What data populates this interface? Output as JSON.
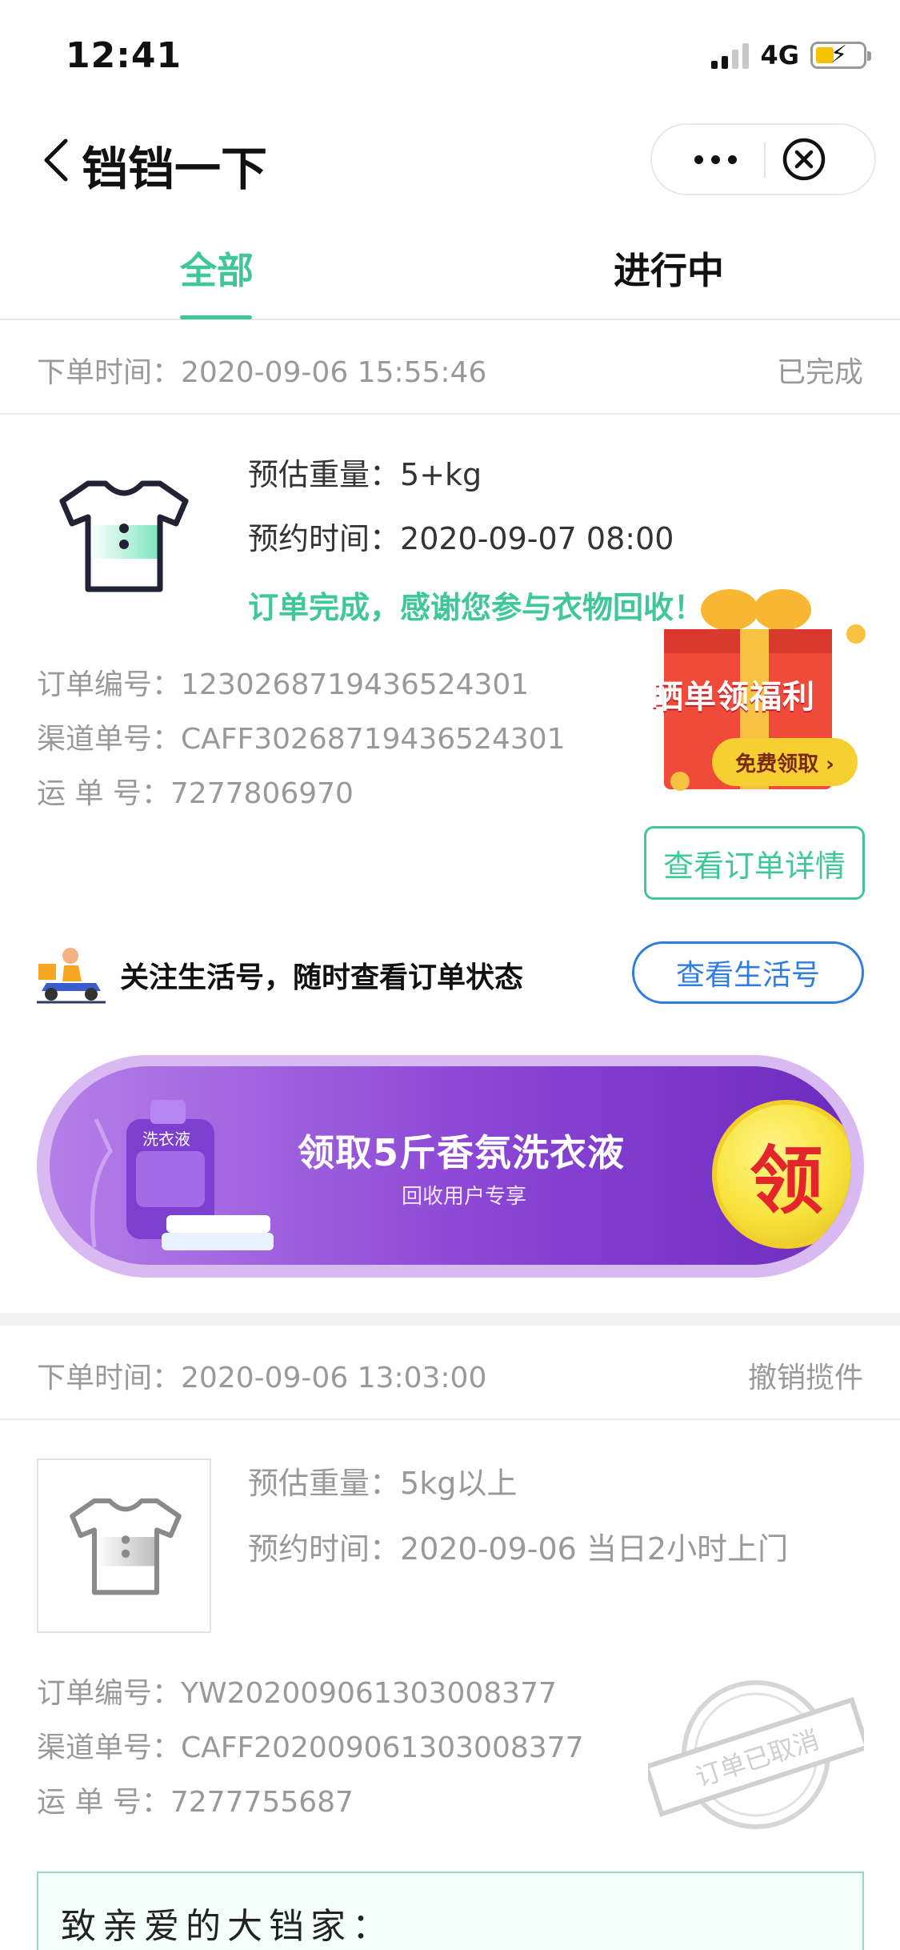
{
  "status_bar": {
    "time": "12:41",
    "network": "4G"
  },
  "nav": {
    "title": "铛铛一下"
  },
  "tabs": [
    {
      "label": "全部",
      "active": true
    },
    {
      "label": "进行中",
      "active": false
    }
  ],
  "colors": {
    "accent": "#3fc79a",
    "link_blue": "#2f7de1"
  },
  "orders": [
    {
      "order_time_label": "下单时间：",
      "order_time": "2020-09-06 15:55:46",
      "status": "已完成",
      "weight_label": "预估重量：",
      "weight": "5+kg",
      "appointment_label": "预约时间：",
      "appointment": "2020-09-07 08:00",
      "message": "订单完成，感谢您参与衣物回收！",
      "order_no_label": "订单编号：",
      "order_no": "1230268719436524301",
      "channel_no_label": "渠道单号：",
      "channel_no": "CAFF30268719436524301",
      "waybill_label": "运 单 号：",
      "waybill_no": "7277806970",
      "detail_button": "查看订单详情"
    },
    {
      "order_time_label": "下单时间：",
      "order_time": "2020-09-06 13:03:00",
      "status": "撤销揽件",
      "weight_label": "预估重量：",
      "weight": "5kg以上",
      "appointment_label": "预约时间：",
      "appointment": "2020-09-06 当日2小时上门",
      "order_no_label": "订单编号：",
      "order_no": "YW202009061303008377",
      "channel_no_label": "渠道单号：",
      "channel_no": "CAFF202009061303008377",
      "waybill_label": "运 单 号：",
      "waybill_no": "7277755687",
      "stamp_text": "订单已取消"
    }
  ],
  "gift": {
    "label": "晒单领福利",
    "button": "免费领取 ›"
  },
  "follow": {
    "text": "关注生活号，随时查看订单状态",
    "button": "查看生活号"
  },
  "banner": {
    "title": "领取5斤香氛洗衣液",
    "subtitle": "回收用户专享",
    "coin": "领",
    "product_brand": "洗衣液"
  },
  "letter": {
    "greeting": "致亲爱的大铛家："
  },
  "icons": [
    "back-icon",
    "more-icon",
    "close-circle-icon",
    "tshirt-icon",
    "delivery-scooter-icon"
  ]
}
